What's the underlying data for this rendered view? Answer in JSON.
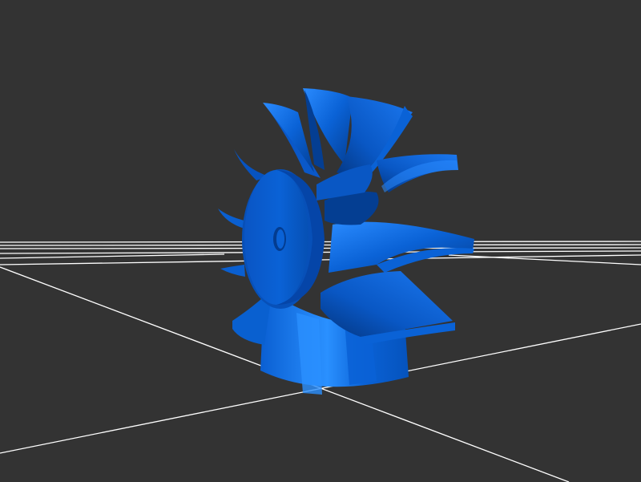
{
  "viewport": {
    "background": "#333333"
  },
  "grid": {
    "color": "#ffffff",
    "visible": true
  },
  "model": {
    "kind": "impeller",
    "blade_count": 12,
    "colors": {
      "base": "#0a62d6",
      "light": "#2a8bff",
      "dark": "#043e92",
      "shadow": "#022b6c"
    }
  }
}
